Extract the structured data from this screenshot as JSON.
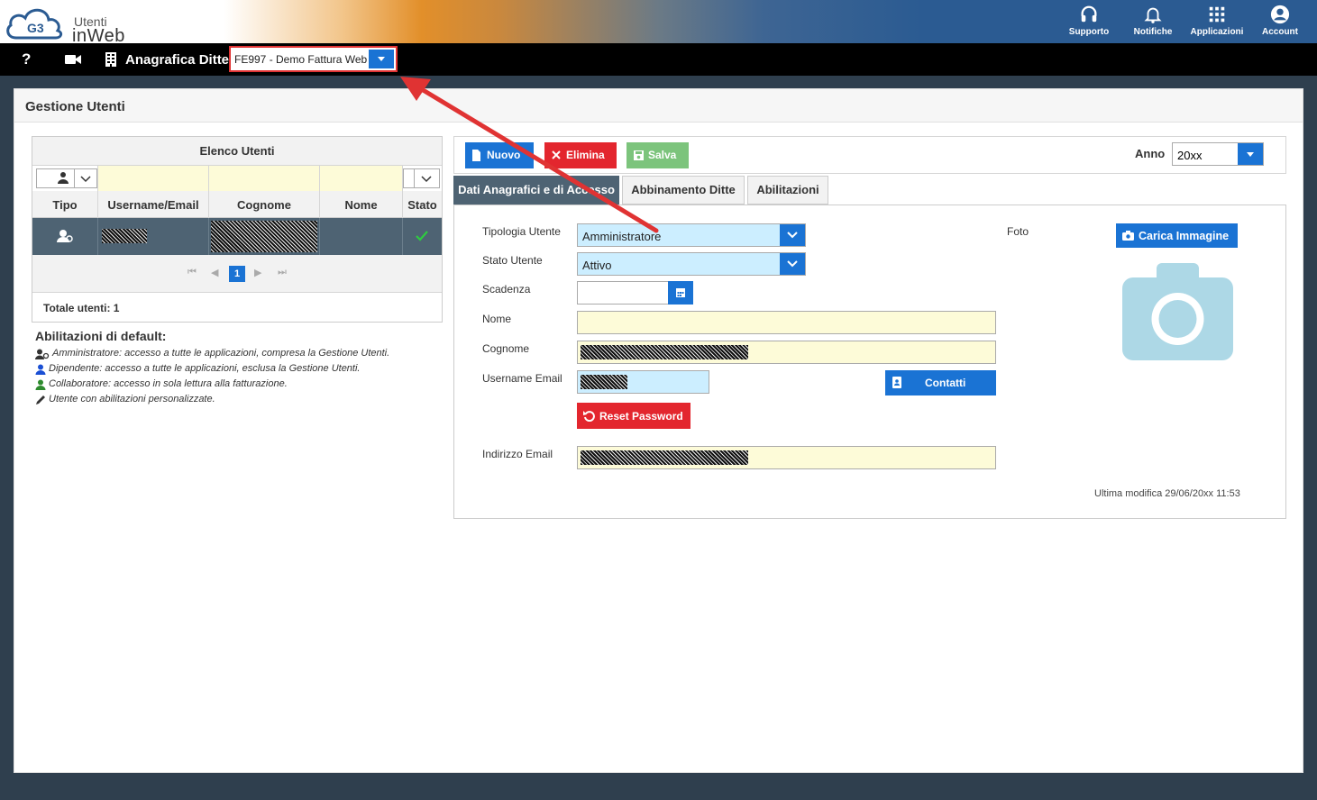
{
  "header": {
    "logo_badge": "G3",
    "logo_line1": "Utenti",
    "logo_line2": "inWeb",
    "buttons": [
      {
        "label": "Supporto",
        "icon": "headset-icon"
      },
      {
        "label": "Notifiche",
        "icon": "bell-icon"
      },
      {
        "label": "Applicazioni",
        "icon": "grid-icon"
      },
      {
        "label": "Account",
        "icon": "user-circle-icon"
      }
    ]
  },
  "toolbar": {
    "help": "?",
    "title": "Anagrafica Ditte",
    "company_select": "FE997 - Demo Fattura Web"
  },
  "page": {
    "title": "Gestione Utenti"
  },
  "users_grid": {
    "caption": "Elenco Utenti",
    "columns": [
      "Tipo",
      "Username/Email",
      "Cognome",
      "Nome",
      "Stato"
    ],
    "pager_page": "1",
    "total": "Totale utenti: 1"
  },
  "legend": {
    "title": "Abilitazioni di default:",
    "items": [
      {
        "text": "Amministratore: accesso a tutte le applicazioni, compresa la Gestione Utenti.",
        "color": "#333333",
        "icon": "admin-user-icon"
      },
      {
        "text": "Dipendente: accesso a tutte le applicazioni, esclusa la Gestione Utenti.",
        "color": "#1a4fd4",
        "icon": "user-icon"
      },
      {
        "text": "Collaboratore: accesso in sola lettura alla fatturazione.",
        "color": "#2e8b2e",
        "icon": "user-icon"
      },
      {
        "text": "Utente con abilitazioni personalizzate.",
        "color": "#333333",
        "icon": "pencil-icon"
      }
    ]
  },
  "actions": {
    "new_label": "Nuovo",
    "delete_label": "Elimina",
    "save_label": "Salva",
    "year_label": "Anno",
    "year_value": "20xx"
  },
  "tabs": [
    {
      "label": "Dati Anagrafici e di Accesso",
      "active": true
    },
    {
      "label": "Abbinamento Ditte",
      "active": false
    },
    {
      "label": "Abilitazioni",
      "active": false
    }
  ],
  "form": {
    "tipologia_label": "Tipologia Utente",
    "tipologia_value": "Amministratore",
    "stato_label": "Stato Utente",
    "stato_value": "Attivo",
    "scadenza_label": "Scadenza",
    "nome_label": "Nome",
    "cognome_label": "Cognome",
    "username_label": "Username Email",
    "contatti_label": "Contatti",
    "reset_label": "Reset Password",
    "indirizzo_label": "Indirizzo Email",
    "foto_label": "Foto",
    "carica_label": "Carica Immagine",
    "last_modified": "Ultima modifica 29/06/20xx 11:53"
  },
  "colors": {
    "accent": "#1a73d4",
    "danger": "#e3262e",
    "success": "#7cc47c",
    "row_selected": "#4e6373",
    "input_yellow": "#fdfbd8",
    "input_blue": "#cceeff",
    "annotation": "#e03333"
  }
}
